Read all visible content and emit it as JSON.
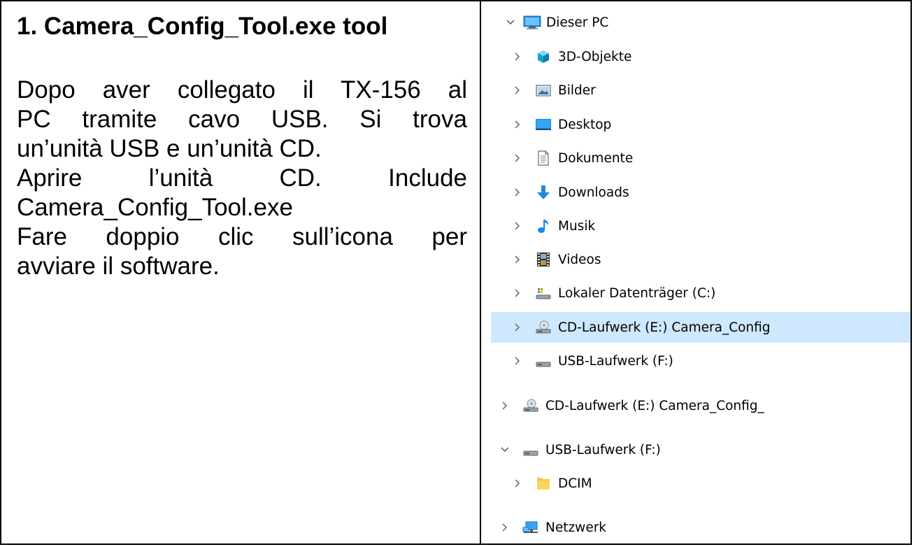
{
  "document": {
    "title": "1. Camera_Config_Tool.exe tool",
    "paragraph_lines": [
      "Dopo aver collegato il TX-156 al",
      "PC tramite cavo USB. Si trova",
      "un’unità USB e un’unità CD.",
      "Aprire l’unità CD. Include",
      "Camera_Config_Tool.exe",
      "Fare doppio clic sull’icona per",
      "avviare il software."
    ]
  },
  "explorer": {
    "items": [
      {
        "label": "Dieser PC",
        "icon": "pc-icon",
        "expanded": true
      },
      {
        "label": "3D-Objekte",
        "icon": "3d-objects-icon"
      },
      {
        "label": "Bilder",
        "icon": "pictures-icon"
      },
      {
        "label": "Desktop",
        "icon": "desktop-icon"
      },
      {
        "label": "Dokumente",
        "icon": "documents-icon"
      },
      {
        "label": "Downloads",
        "icon": "downloads-icon"
      },
      {
        "label": "Musik",
        "icon": "music-icon"
      },
      {
        "label": "Videos",
        "icon": "videos-icon"
      },
      {
        "label": "Lokaler Datenträger (C:)",
        "icon": "local-disk-icon"
      },
      {
        "label": "CD-Laufwerk (E:) Camera_Config",
        "icon": "cd-drive-icon",
        "selected": true
      },
      {
        "label": "USB-Laufwerk (F:)",
        "icon": "usb-drive-icon"
      },
      {
        "label": "CD-Laufwerk (E:) Camera_Config_",
        "icon": "cd-drive-icon"
      },
      {
        "label": "USB-Laufwerk (F:)",
        "icon": "usb-drive-icon",
        "expanded": true
      },
      {
        "label": "DCIM",
        "icon": "folder-icon"
      },
      {
        "label": "Netzwerk",
        "icon": "network-icon"
      }
    ],
    "colors": {
      "selection": "#cde8ff",
      "folder": "#ffd45e",
      "accent": "#1e88e5"
    }
  }
}
